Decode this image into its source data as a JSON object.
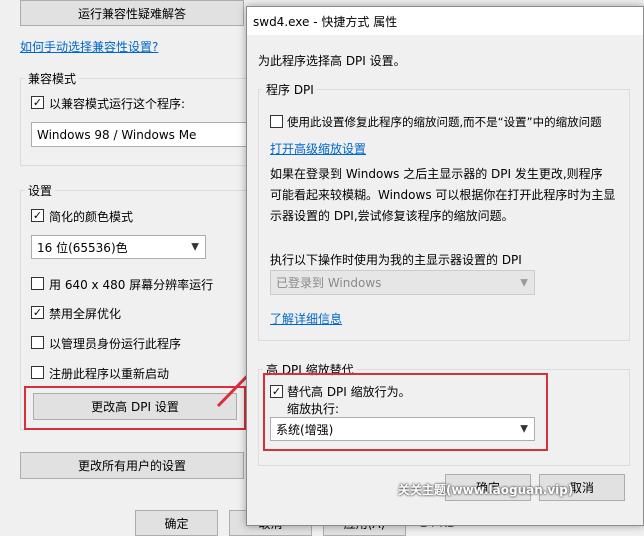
{
  "bg": {
    "troubleshoot_button": "运行兼容性疑难解答",
    "manual_link": "如何手动选择兼容性设置?",
    "compat_group_title": "兼容模式",
    "compat_checkbox_label": "以兼容模式运行这个程序:",
    "compat_select_value": "Windows 98 / Windows Me",
    "settings_group_title": "设置",
    "settings": [
      {
        "label": "简化的颜色模式",
        "checked": true
      },
      {
        "label": "用 640 x 480 屏幕分辨率运行",
        "checked": false
      },
      {
        "label": "禁用全屏优化",
        "checked": true
      },
      {
        "label": "以管理员身份运行此程序",
        "checked": false
      },
      {
        "label": "注册此程序以重新启动",
        "checked": false
      }
    ],
    "color_select_value": "16 位(65536)色",
    "change_dpi_button": "更改高 DPI 设置",
    "change_all_users_button": "更改所有用户的设置",
    "ok_button": "确定",
    "cancel_button": "取消",
    "apply_button": "应用(A)",
    "size_text": "24 KB"
  },
  "dialog": {
    "title": "swd4.exe - 快捷方式 属性",
    "intro": "为此程序选择高 DPI 设置。",
    "program_dpi_title": "程序 DPI",
    "program_dpi_checkbox": "使用此设置修复此程序的缩放问题,而不是“设置”中的缩放问题",
    "open_advanced_link": "打开高级缩放设置",
    "description_lines": [
      "如果在登录到 Windows 之后主显示器的 DPI 发生更改,则程序",
      "可能看起来较模糊。Windows 可以根据你在打开此程序时为主显",
      "示器设置的 DPI,尝试修复该程序的缩放问题。"
    ],
    "use_dpi_label": "执行以下操作时使用为我的主显示器设置的 DPI",
    "use_dpi_select": "已登录到 Windows",
    "learn_more_link": "了解详细信息",
    "high_dpi_title": "高 DPI 缩放替代",
    "override_checkbox": "替代高 DPI 缩放行为。",
    "scaling_label": "缩放执行:",
    "scaling_select": "系统(增强)",
    "ok_button": "确定",
    "cancel_button": "取消"
  },
  "watermark": "关关主题(www.laoguan.vip)",
  "colors": {
    "highlight_red": "#d6303a",
    "link_blue": "#0066cc"
  }
}
